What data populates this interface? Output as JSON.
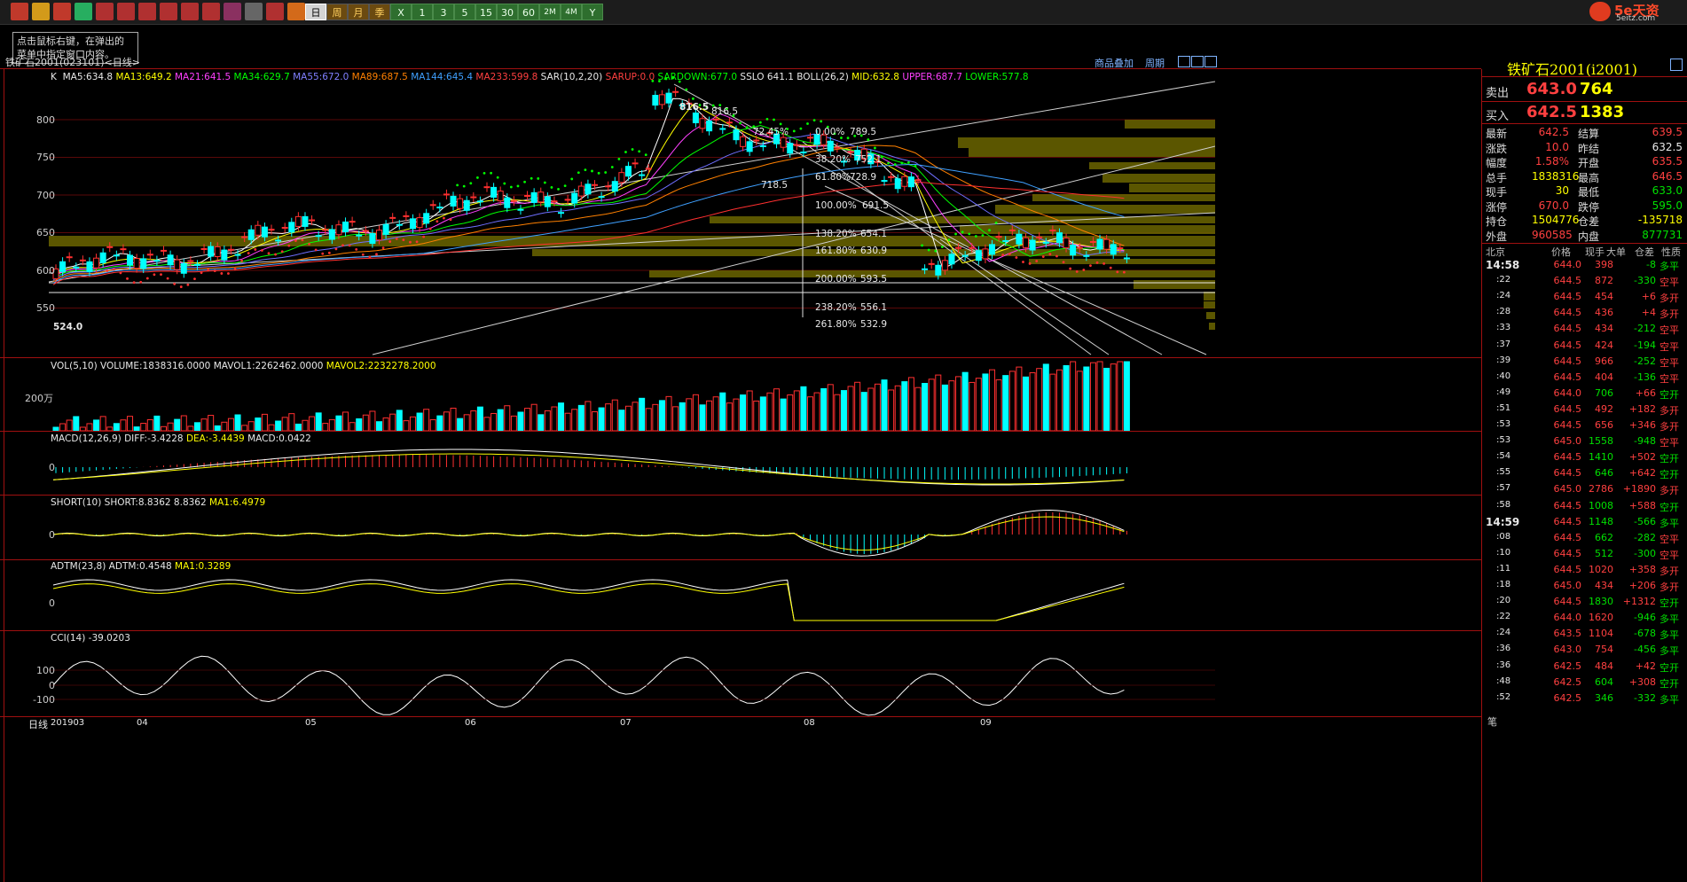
{
  "toolbar": {
    "period_buttons": [
      "日",
      "周",
      "月",
      "季",
      "X",
      "1",
      "3",
      "5",
      "15",
      "30",
      "60",
      "2M",
      "4M",
      "Y"
    ],
    "selected": "日"
  },
  "brand": {
    "logo_text": "5e天资",
    "logo_sub": "5eitz.com"
  },
  "note": {
    "line1": "点击鼠标右键，在弹出的",
    "line2": "菜单中指定窗口内容。"
  },
  "header": {
    "instrument": "铁矿石2001",
    "code": "(023101)",
    "period": "<日线>",
    "link_overlay": "商品叠加",
    "link_cycle": "周期"
  },
  "main_indicators": {
    "k": "K",
    "ma5": "MA5:634.8",
    "ma13": "MA13:649.2",
    "ma21": "MA21:641.5",
    "ma34": "MA34:629.7",
    "ma55": "MA55:672.0",
    "ma89": "MA89:687.5",
    "ma144": "MA144:645.4",
    "ma233": "MA233:599.8",
    "sar": "SAR(10,2,20)",
    "sarup": "SARUP:0.0",
    "sardown": "SARDOWN:677.0",
    "sslo": "SSLO 641.1",
    "boll": "BOLL(26,2)",
    "mid": "MID:632.8",
    "upper": "UPPER:687.7",
    "lower": "LOWER:577.8"
  },
  "price_axis": [
    "800",
    "750",
    "700",
    "650",
    "600",
    "550"
  ],
  "price_marks": {
    "high": "816.5",
    "high2": "816.5",
    "low": "524.0",
    "mid_low": "718.5"
  },
  "fib": [
    {
      "pct": "72.45%",
      "val": ""
    },
    {
      "pct": "0.00%",
      "val": "789.5"
    },
    {
      "pct": "38.20%",
      "val": "752.1"
    },
    {
      "pct": "61.80%",
      "val": "728.9"
    },
    {
      "pct": "100.00%",
      "val": "691.5"
    },
    {
      "pct": "138.20%",
      "val": "654.1"
    },
    {
      "pct": "161.80%",
      "val": "630.9"
    },
    {
      "pct": "200.00%",
      "val": "593.5"
    },
    {
      "pct": "238.20%",
      "val": "556.1"
    },
    {
      "pct": "261.80%",
      "val": "532.9"
    }
  ],
  "vol_panel": {
    "title": "VOL(5,10)",
    "volume": "VOLUME:1838316.0000",
    "mavol1": "MAVOL1:2262462.0000",
    "mavol2": "MAVOL2:2232278.2000",
    "axis": "200万"
  },
  "macd_panel": {
    "title": "MACD(12,26,9)",
    "diff": "DIFF:-3.4228",
    "dea": "DEA:-3.4439",
    "macd": "MACD:0.0422",
    "axis": "0"
  },
  "short_panel": {
    "title": "SHORT(10)",
    "short": "SHORT:8.8362",
    "val": "8.8362",
    "ma": "MA1:6.4979",
    "axis": "0"
  },
  "adtm_panel": {
    "title": "ADTM(23,8)",
    "adtm": "ADTM:0.4548",
    "ma": "MA1:0.3289",
    "axis": "0"
  },
  "cci_panel": {
    "title": "CCI(14)",
    "val": "-39.0203",
    "axis": [
      "100",
      "0",
      "-100"
    ]
  },
  "time_axis": {
    "left_label": "日线",
    "labels": [
      "201903",
      "04",
      "05",
      "06",
      "07",
      "08",
      "09"
    ]
  },
  "quote": {
    "title": "铁矿石2001(i2001)",
    "sell_label": "卖出",
    "sell_price": "643.0",
    "sell_qty": "764",
    "buy_label": "买入",
    "buy_price": "642.5",
    "buy_qty": "1383",
    "rows": [
      {
        "l1": "最新",
        "v1": "642.5",
        "l2": "结算",
        "v2": "639.5"
      },
      {
        "l1": "涨跌",
        "v1": "10.0",
        "l2": "昨结",
        "v2": "632.5"
      },
      {
        "l1": "幅度",
        "v1": "1.58%",
        "l2": "开盘",
        "v2": "635.5"
      },
      {
        "l1": "总手",
        "v1": "1838316",
        "l2": "最高",
        "v2": "646.5"
      },
      {
        "l1": "现手",
        "v1": "30",
        "l2": "最低",
        "v2": "633.0"
      },
      {
        "l1": "涨停",
        "v1": "670.0",
        "l2": "跌停",
        "v2": "595.0"
      },
      {
        "l1": "持仓",
        "v1": "1504776",
        "l2": "仓差",
        "v2": "-135718"
      },
      {
        "l1": "外盘",
        "v1": "960585",
        "l2": "内盘",
        "v2": "877731"
      }
    ],
    "tick_header": {
      "place": "北京",
      "price": "价格",
      "vol": "现手",
      "big": "大单",
      "oi": "仓差",
      "nature": "性质"
    },
    "ticks": [
      {
        "t": "14:58",
        "p": "644.0",
        "v": "398",
        "d": "-8",
        "n": "多平"
      },
      {
        "t": ":22",
        "p": "644.5",
        "v": "872",
        "d": "-330",
        "n": "空平"
      },
      {
        "t": ":24",
        "p": "644.5",
        "v": "454",
        "d": "+6",
        "n": "多开"
      },
      {
        "t": ":28",
        "p": "644.5",
        "v": "436",
        "d": "+4",
        "n": "多开"
      },
      {
        "t": ":33",
        "p": "644.5",
        "v": "434",
        "d": "-212",
        "n": "空平"
      },
      {
        "t": ":37",
        "p": "644.5",
        "v": "424",
        "d": "-194",
        "n": "空平"
      },
      {
        "t": ":39",
        "p": "644.5",
        "v": "966",
        "d": "-252",
        "n": "空平"
      },
      {
        "t": ":40",
        "p": "644.5",
        "v": "404",
        "d": "-136",
        "n": "空平"
      },
      {
        "t": ":49",
        "p": "644.0",
        "v": "706",
        "d": "+66",
        "n": "空开"
      },
      {
        "t": ":51",
        "p": "644.5",
        "v": "492",
        "d": "+182",
        "n": "多开"
      },
      {
        "t": ":53",
        "p": "644.5",
        "v": "656",
        "d": "+346",
        "n": "多开"
      },
      {
        "t": ":53",
        "p": "645.0",
        "v": "1558",
        "d": "-948",
        "n": "空平"
      },
      {
        "t": ":54",
        "p": "644.5",
        "v": "1410",
        "d": "+502",
        "n": "空开"
      },
      {
        "t": ":55",
        "p": "644.5",
        "v": "646",
        "d": "+642",
        "n": "空开"
      },
      {
        "t": ":57",
        "p": "645.0",
        "v": "2786",
        "d": "+1890",
        "n": "多开"
      },
      {
        "t": ":58",
        "p": "644.5",
        "v": "1008",
        "d": "+588",
        "n": "空开"
      },
      {
        "t": "14:59",
        "p": "644.5",
        "v": "1148",
        "d": "-566",
        "n": "多平"
      },
      {
        "t": ":08",
        "p": "644.5",
        "v": "662",
        "d": "-282",
        "n": "空平"
      },
      {
        "t": ":10",
        "p": "644.5",
        "v": "512",
        "d": "-300",
        "n": "空平"
      },
      {
        "t": ":11",
        "p": "644.5",
        "v": "1020",
        "d": "+358",
        "n": "多开"
      },
      {
        "t": ":18",
        "p": "645.0",
        "v": "434",
        "d": "+206",
        "n": "多开"
      },
      {
        "t": ":20",
        "p": "644.5",
        "v": "1830",
        "d": "+1312",
        "n": "空开"
      },
      {
        "t": ":22",
        "p": "644.0",
        "v": "1620",
        "d": "-946",
        "n": "多平"
      },
      {
        "t": ":24",
        "p": "643.5",
        "v": "1104",
        "d": "-678",
        "n": "多平"
      },
      {
        "t": ":36",
        "p": "643.0",
        "v": "754",
        "d": "-456",
        "n": "多平"
      },
      {
        "t": ":36",
        "p": "642.5",
        "v": "484",
        "d": "+42",
        "n": "空开"
      },
      {
        "t": ":48",
        "p": "642.5",
        "v": "604",
        "d": "+308",
        "n": "空开"
      },
      {
        "t": ":52",
        "p": "642.5",
        "v": "346",
        "d": "-332",
        "n": "多平"
      }
    ],
    "footer": "笔"
  },
  "colors": {
    "up": "#ff3030",
    "down": "#00ffff",
    "ma5": "#ffffff",
    "ma13": "#ffff00",
    "ma21": "#ff00ff",
    "ma34": "#00ff00",
    "ma55": "#6f6fff",
    "ma89": "#ff8000",
    "ma144": "#3fa0ff",
    "ma233": "#ff3030",
    "grid": "#a01010"
  }
}
